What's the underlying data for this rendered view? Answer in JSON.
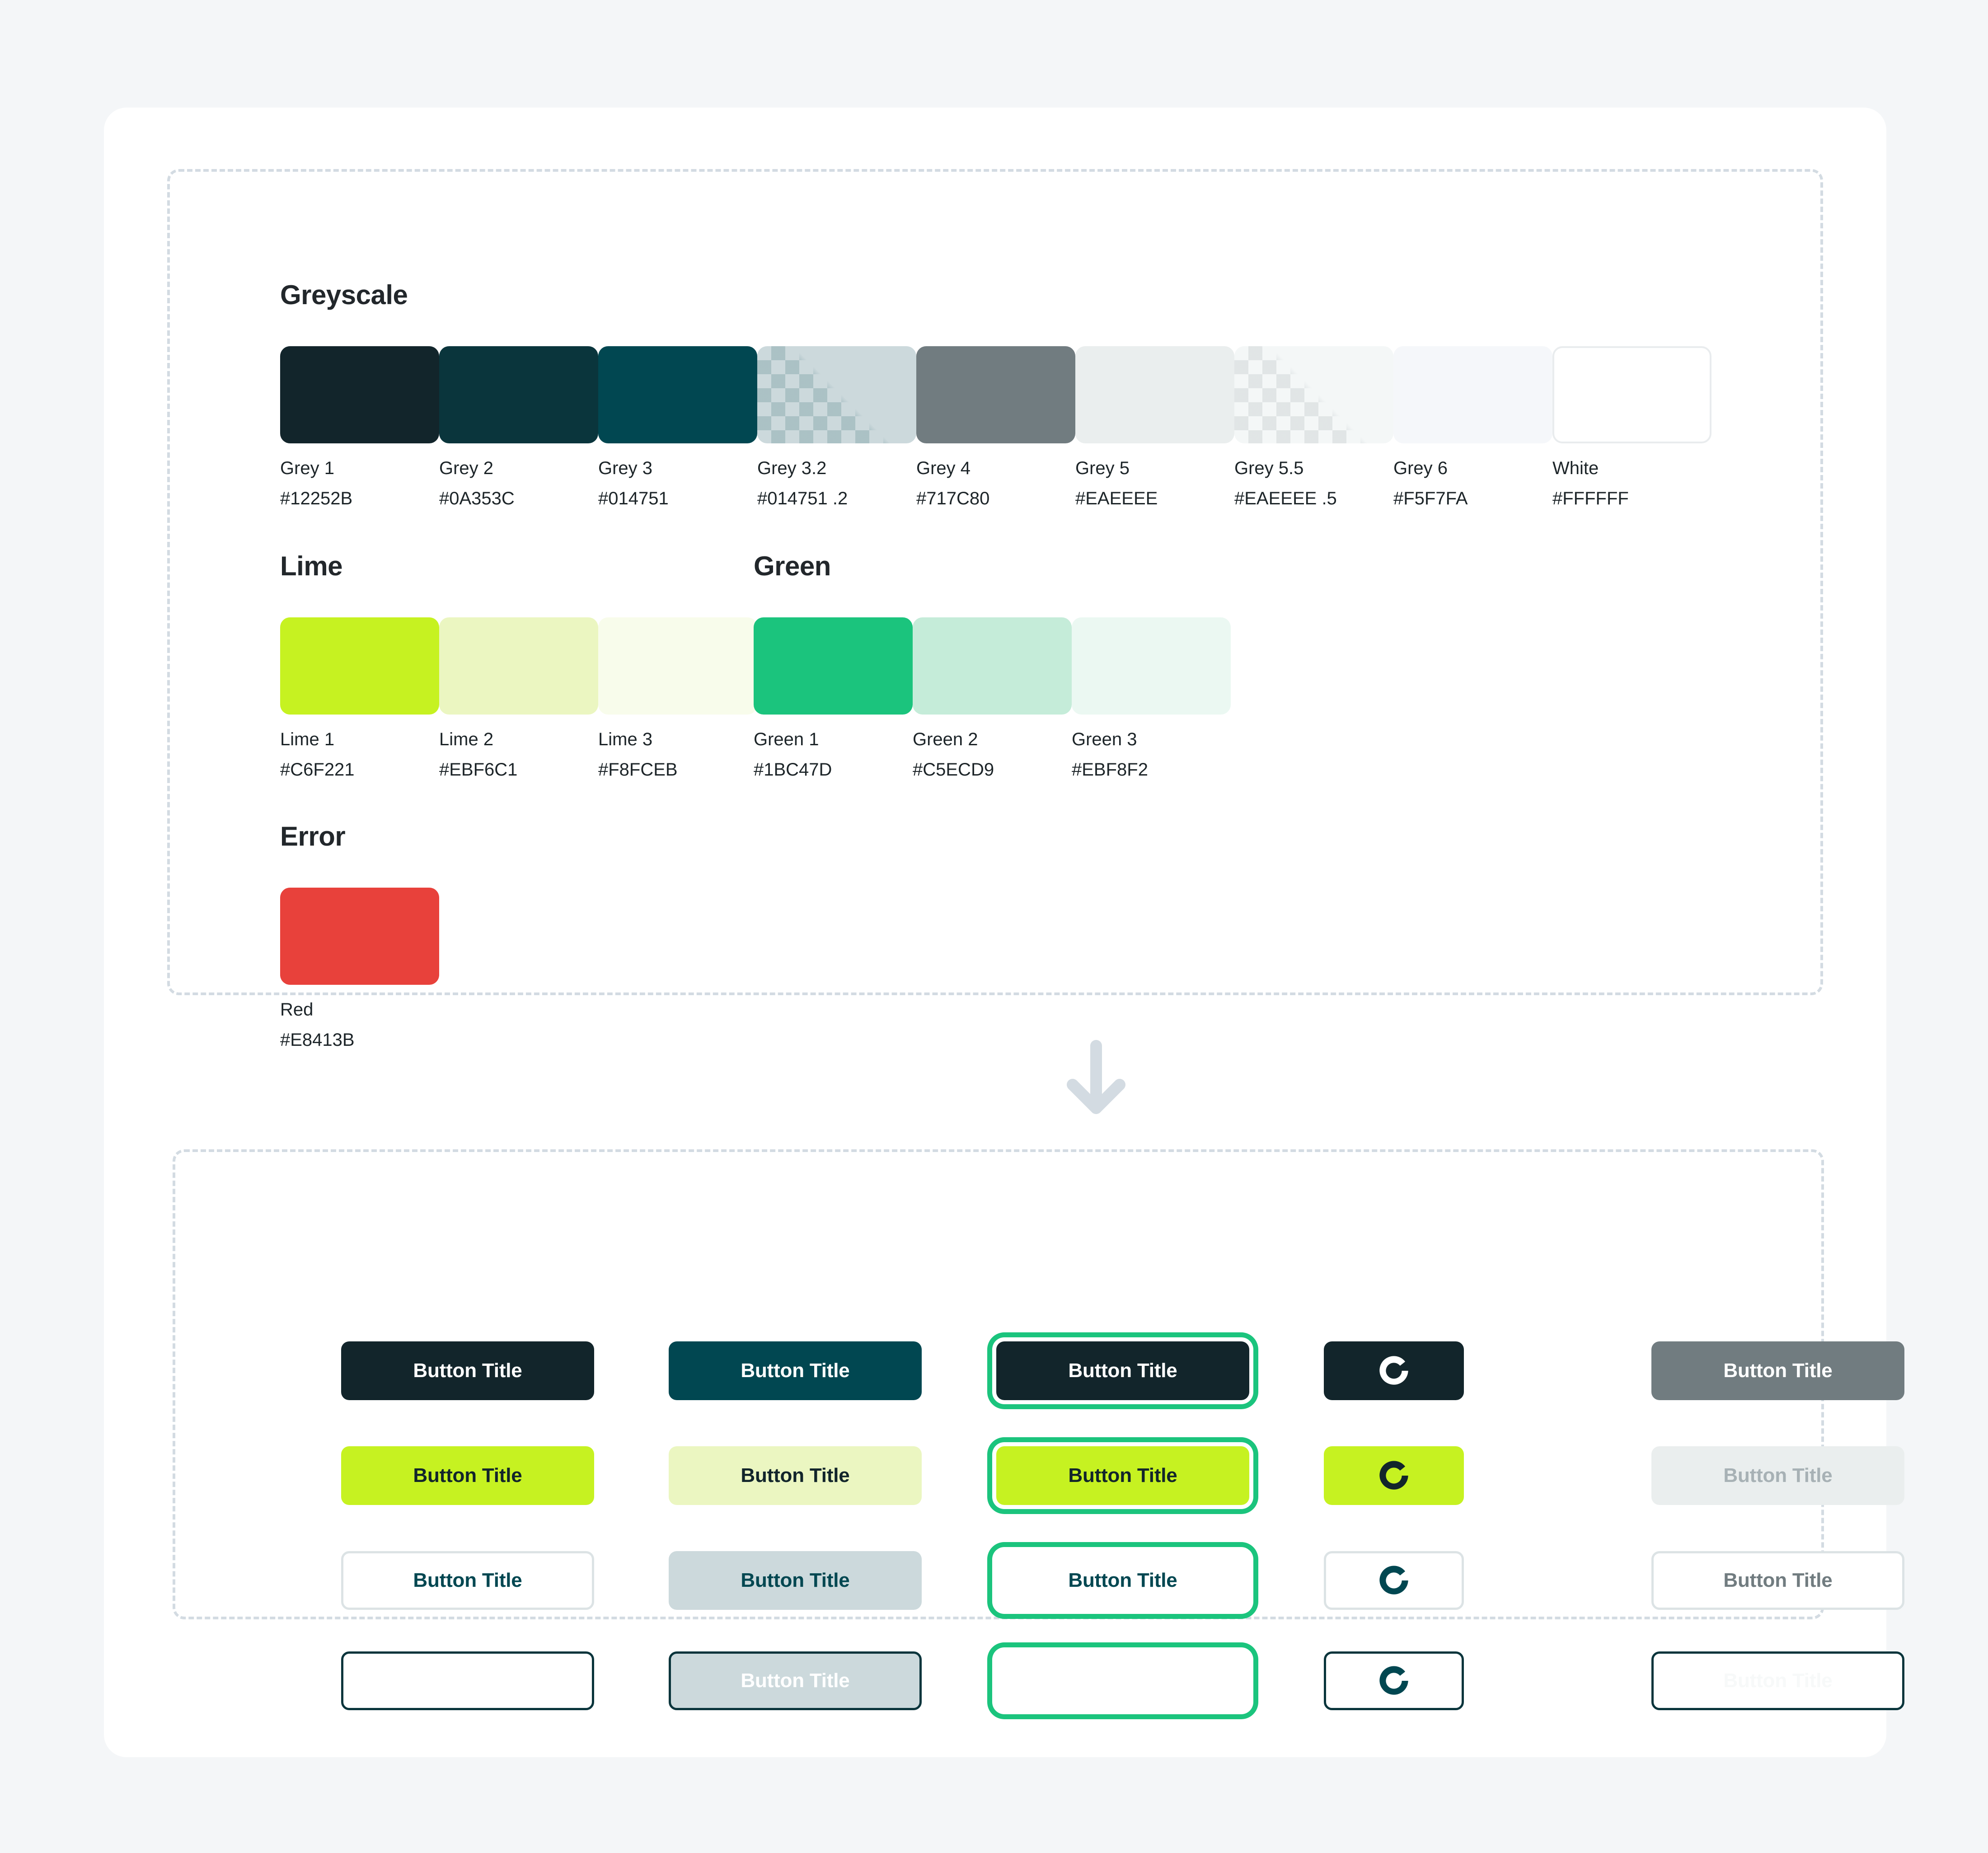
{
  "palette": {
    "groups": [
      {
        "title": "Greyscale",
        "swatches": [
          {
            "name": "Grey 1",
            "hex": "#12252B",
            "color": "#12252B",
            "checker": false,
            "border": false
          },
          {
            "name": "Grey 2",
            "hex": "#0A353C",
            "color": "#0A353C",
            "checker": false,
            "border": false
          },
          {
            "name": "Grey 3",
            "hex": "#014751",
            "color": "#014751",
            "checker": false,
            "border": false
          },
          {
            "name": "Grey 3.2",
            "hex": "#014751 .2",
            "color": "#CCD9DC",
            "checker": true,
            "border": false
          },
          {
            "name": "Grey 4",
            "hex": "#717C80",
            "color": "#717C80",
            "checker": false,
            "border": false
          },
          {
            "name": "Grey 5",
            "hex": "#EAEEEE",
            "color": "#EAEEEE",
            "checker": false,
            "border": false
          },
          {
            "name": "Grey 5.5",
            "hex": "#EAEEEE .5",
            "color": "#F4F7F7",
            "checker": true,
            "border": false
          },
          {
            "name": "Grey 6",
            "hex": "#F5F7FA",
            "color": "#F5F7FA",
            "checker": false,
            "border": false
          },
          {
            "name": "White",
            "hex": "#FFFFFF",
            "color": "#FFFFFF",
            "checker": false,
            "border": true
          }
        ]
      },
      {
        "title": "Lime",
        "swatches": [
          {
            "name": "Lime 1",
            "hex": "#C6F221",
            "color": "#C6F221",
            "checker": false,
            "border": false
          },
          {
            "name": "Lime 2",
            "hex": "#EBF6C1",
            "color": "#EBF6C1",
            "checker": false,
            "border": false
          },
          {
            "name": "Lime 3",
            "hex": "#F8FCEB",
            "color": "#F8FCEB",
            "checker": false,
            "border": false
          }
        ]
      },
      {
        "title": "Green",
        "swatches": [
          {
            "name": "Green 1",
            "hex": "#1BC47D",
            "color": "#1BC47D",
            "checker": false,
            "border": false
          },
          {
            "name": "Green 2",
            "hex": "#C5ECD9",
            "color": "#C5ECD9",
            "checker": false,
            "border": false
          },
          {
            "name": "Green 3",
            "hex": "#EBF8F2",
            "color": "#EBF8F2",
            "checker": false,
            "border": false
          }
        ]
      },
      {
        "title": "Error",
        "swatches": [
          {
            "name": "Red",
            "hex": "#E8413B",
            "color": "#E8413B",
            "checker": false,
            "border": false
          }
        ]
      }
    ]
  },
  "buttons": {
    "label": "Button Title",
    "spinner_icon": "spinner-icon",
    "rows": [
      [
        {
          "label": "Button Title",
          "bg": "#12252B",
          "fg": "#FFFFFF",
          "border": "none",
          "kind": "wide",
          "focus": false
        },
        {
          "label": "Button Title",
          "bg": "#014751",
          "fg": "#FFFFFF",
          "border": "none",
          "kind": "wide",
          "focus": false
        },
        {
          "label": "Button Title",
          "bg": "#12252B",
          "fg": "#FFFFFF",
          "border": "none",
          "kind": "wide",
          "focus": true
        },
        {
          "label": "",
          "bg": "#12252B",
          "fg": "#FFFFFF",
          "border": "none",
          "kind": "icon",
          "focus": false
        },
        {
          "label": "Button Title",
          "bg": "#717C80",
          "fg": "#FFFFFF",
          "border": "none",
          "kind": "wide",
          "focus": false
        }
      ],
      [
        {
          "label": "Button Title",
          "bg": "#C6F221",
          "fg": "#12252B",
          "border": "none",
          "kind": "wide",
          "focus": false
        },
        {
          "label": "Button Title",
          "bg": "#EBF6C1",
          "fg": "#12252B",
          "border": "none",
          "kind": "wide",
          "focus": false
        },
        {
          "label": "Button Title",
          "bg": "#C6F221",
          "fg": "#12252B",
          "border": "none",
          "kind": "wide",
          "focus": true
        },
        {
          "label": "",
          "bg": "#C6F221",
          "fg": "#12252B",
          "border": "none",
          "kind": "icon",
          "focus": false
        },
        {
          "label": "Button Title",
          "bg": "#EAEEEE",
          "fg": "#A7B1B5",
          "border": "none",
          "kind": "wide",
          "focus": false
        }
      ],
      [
        {
          "label": "Button Title",
          "bg": "#FFFFFF",
          "fg": "#014751",
          "border": "#DCE3E5",
          "kind": "wide",
          "focus": false
        },
        {
          "label": "Button Title",
          "bg": "#CCD9DC",
          "fg": "#014751",
          "border": "none",
          "kind": "wide",
          "focus": false
        },
        {
          "label": "Button Title",
          "bg": "#FFFFFF",
          "fg": "#014751",
          "border": "#FFFFFF",
          "kind": "wide",
          "focus": true
        },
        {
          "label": "",
          "bg": "#FFFFFF",
          "fg": "#014751",
          "border": "#DCE3E5",
          "kind": "icon",
          "focus": false
        },
        {
          "label": "Button Title",
          "bg": "#FFFFFF",
          "fg": "#717C80",
          "border": "#DCE3E5",
          "kind": "wide",
          "focus": false
        }
      ],
      [
        {
          "label": "",
          "bg": "#FFFFFF",
          "fg": "#014751",
          "border": "#0A353C",
          "kind": "wide",
          "focus": false
        },
        {
          "label": "Button Title",
          "bg": "#CCD9DC",
          "fg": "#FFFFFF",
          "border": "#0A353C",
          "kind": "wide",
          "focus": false
        },
        {
          "label": "",
          "bg": "#FFFFFF",
          "fg": "#014751",
          "border": "#FFFFFF",
          "kind": "wide",
          "focus": true
        },
        {
          "label": "",
          "bg": "#FFFFFF",
          "fg": "#014751",
          "border": "#0A353C",
          "kind": "icon",
          "focus": false
        },
        {
          "label": "Button Title",
          "bg": "#FFFFFF",
          "fg": "#F7F9F9",
          "border": "#0A353C",
          "kind": "wide",
          "focus": false
        }
      ]
    ]
  },
  "flow": {
    "arrow_icon": "arrow-down-icon",
    "arrow_color": "#D3DBE2"
  }
}
